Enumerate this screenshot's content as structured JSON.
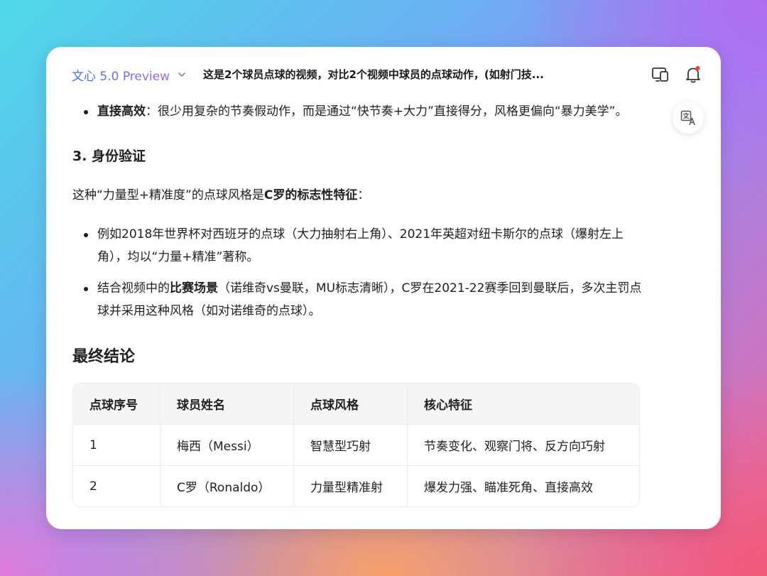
{
  "header": {
    "model_name": "文心 5.0 Preview",
    "conversation_title": "这是2个球员点球的视频，对比2个视频中球员的点球动作，(如射门技..."
  },
  "icons": {
    "chevron": "chevron-down-icon",
    "device": "multi-device-icon",
    "bell": "notification-bell-icon",
    "translate": "translate-icon"
  },
  "colors": {
    "accent": "#4f6ef7",
    "notify_dot": "#e8443a"
  },
  "content": {
    "bullet_top": {
      "bold": "直接高效",
      "text": "：很少用复杂的节奏假动作，而是通过“快节奏+大力”直接得分，风格更偏向“暴力美学”。"
    },
    "section3_heading": "3. 身份验证",
    "intro": {
      "prefix": "这种“力量型+精准度”的点球风格是",
      "bold": "C罗的标志性特征",
      "suffix": "："
    },
    "bullet1": {
      "line1": "例如2018年世界杯对西班牙的点球（大力抽射右上角）、2021年英超对纽卡斯尔的点球（爆射左上",
      "line2": "角），均以“力量+精准”著称。"
    },
    "bullet2": {
      "prefix": "结合视频中的",
      "bold": "比赛场景",
      "line1_rest": "（诺维奇vs曼联，MU标志清晰），C罗在2021-22赛季回到曼联后，多次主罚点",
      "line2": "球并采用这种风格（如对诺维奇的点球）。"
    },
    "final_heading": "最终结论"
  },
  "table": {
    "headers": [
      "点球序号",
      "球员姓名",
      "点球风格",
      "核心特征"
    ],
    "rows": [
      [
        "1",
        "梅西（Messi）",
        "智慧型巧射",
        "节奏变化、观察门将、反方向巧射"
      ],
      [
        "2",
        "C罗（Ronaldo）",
        "力量型精准射",
        "爆发力强、瞄准死角、直接高效"
      ]
    ]
  }
}
